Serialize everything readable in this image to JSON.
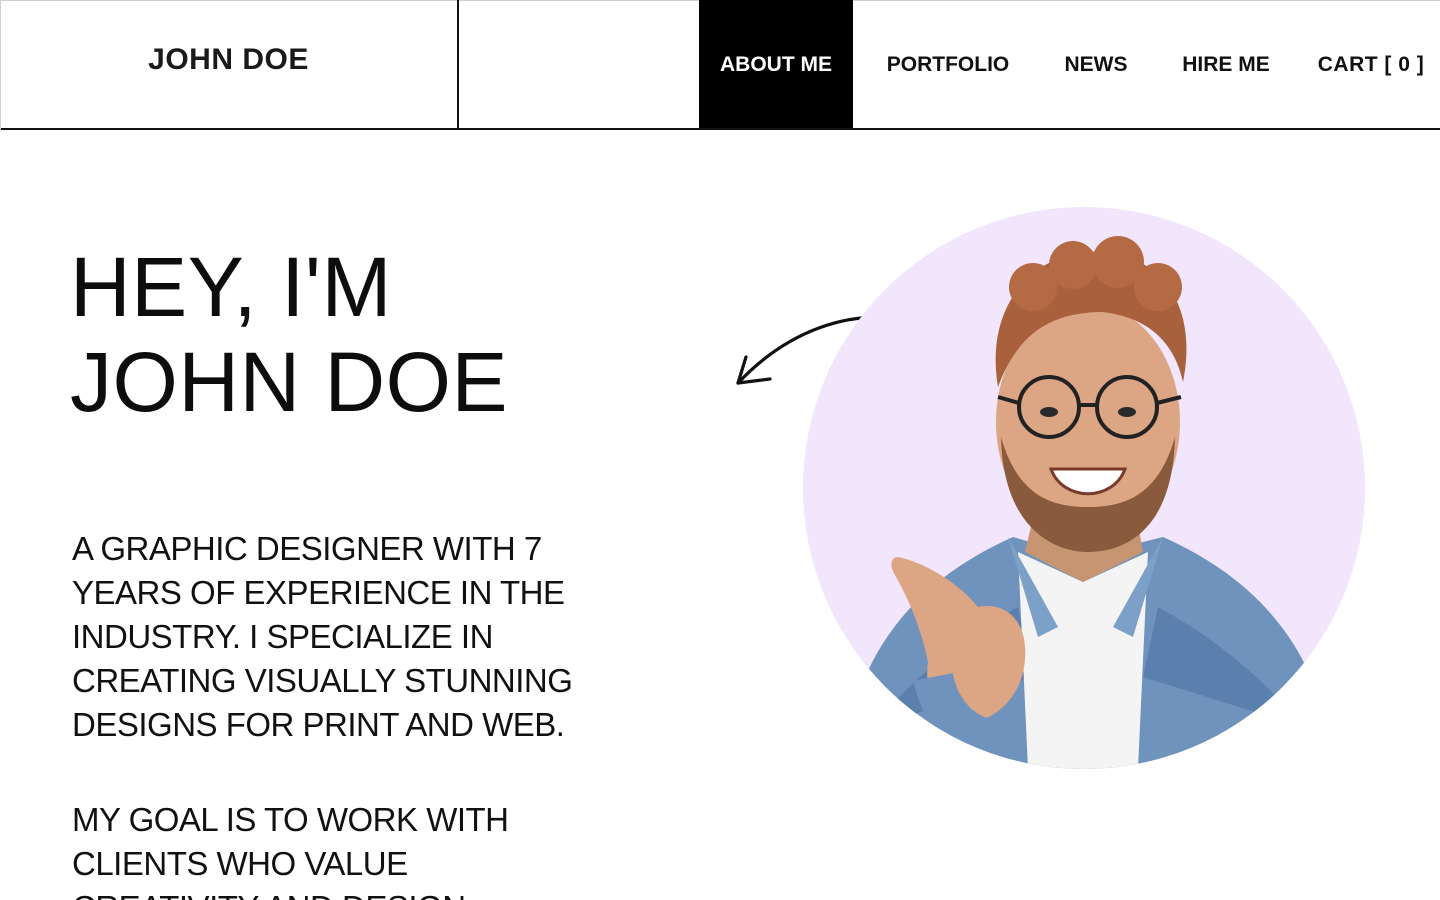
{
  "header": {
    "brand": "JOHN DOE",
    "nav": [
      {
        "label": "ABOUT ME",
        "active": true
      },
      {
        "label": "PORTFOLIO",
        "active": false
      },
      {
        "label": "NEWS",
        "active": false
      },
      {
        "label": "HIRE ME",
        "active": false
      },
      {
        "label": "CART [ 0 ]",
        "active": false
      }
    ]
  },
  "hero": {
    "title_line1": "HEY, I'M",
    "title_line2": "JOHN DOE",
    "intro": "A GRAPHIC DESIGNER WITH 7 YEARS OF EXPERIENCE IN THE INDUSTRY. I SPECIALIZE IN CREATING VISUALLY STUNNING DESIGNS FOR PRINT AND WEB.",
    "goal": "MY GOAL IS TO WORK WITH CLIENTS WHO VALUE CREATIVITY AND DESIGN"
  },
  "colors": {
    "accent": "#000000",
    "portrait_bg": "#f1e6fb",
    "text": "#111111"
  },
  "icons": {
    "arrow": "curved-arrow-icon"
  }
}
